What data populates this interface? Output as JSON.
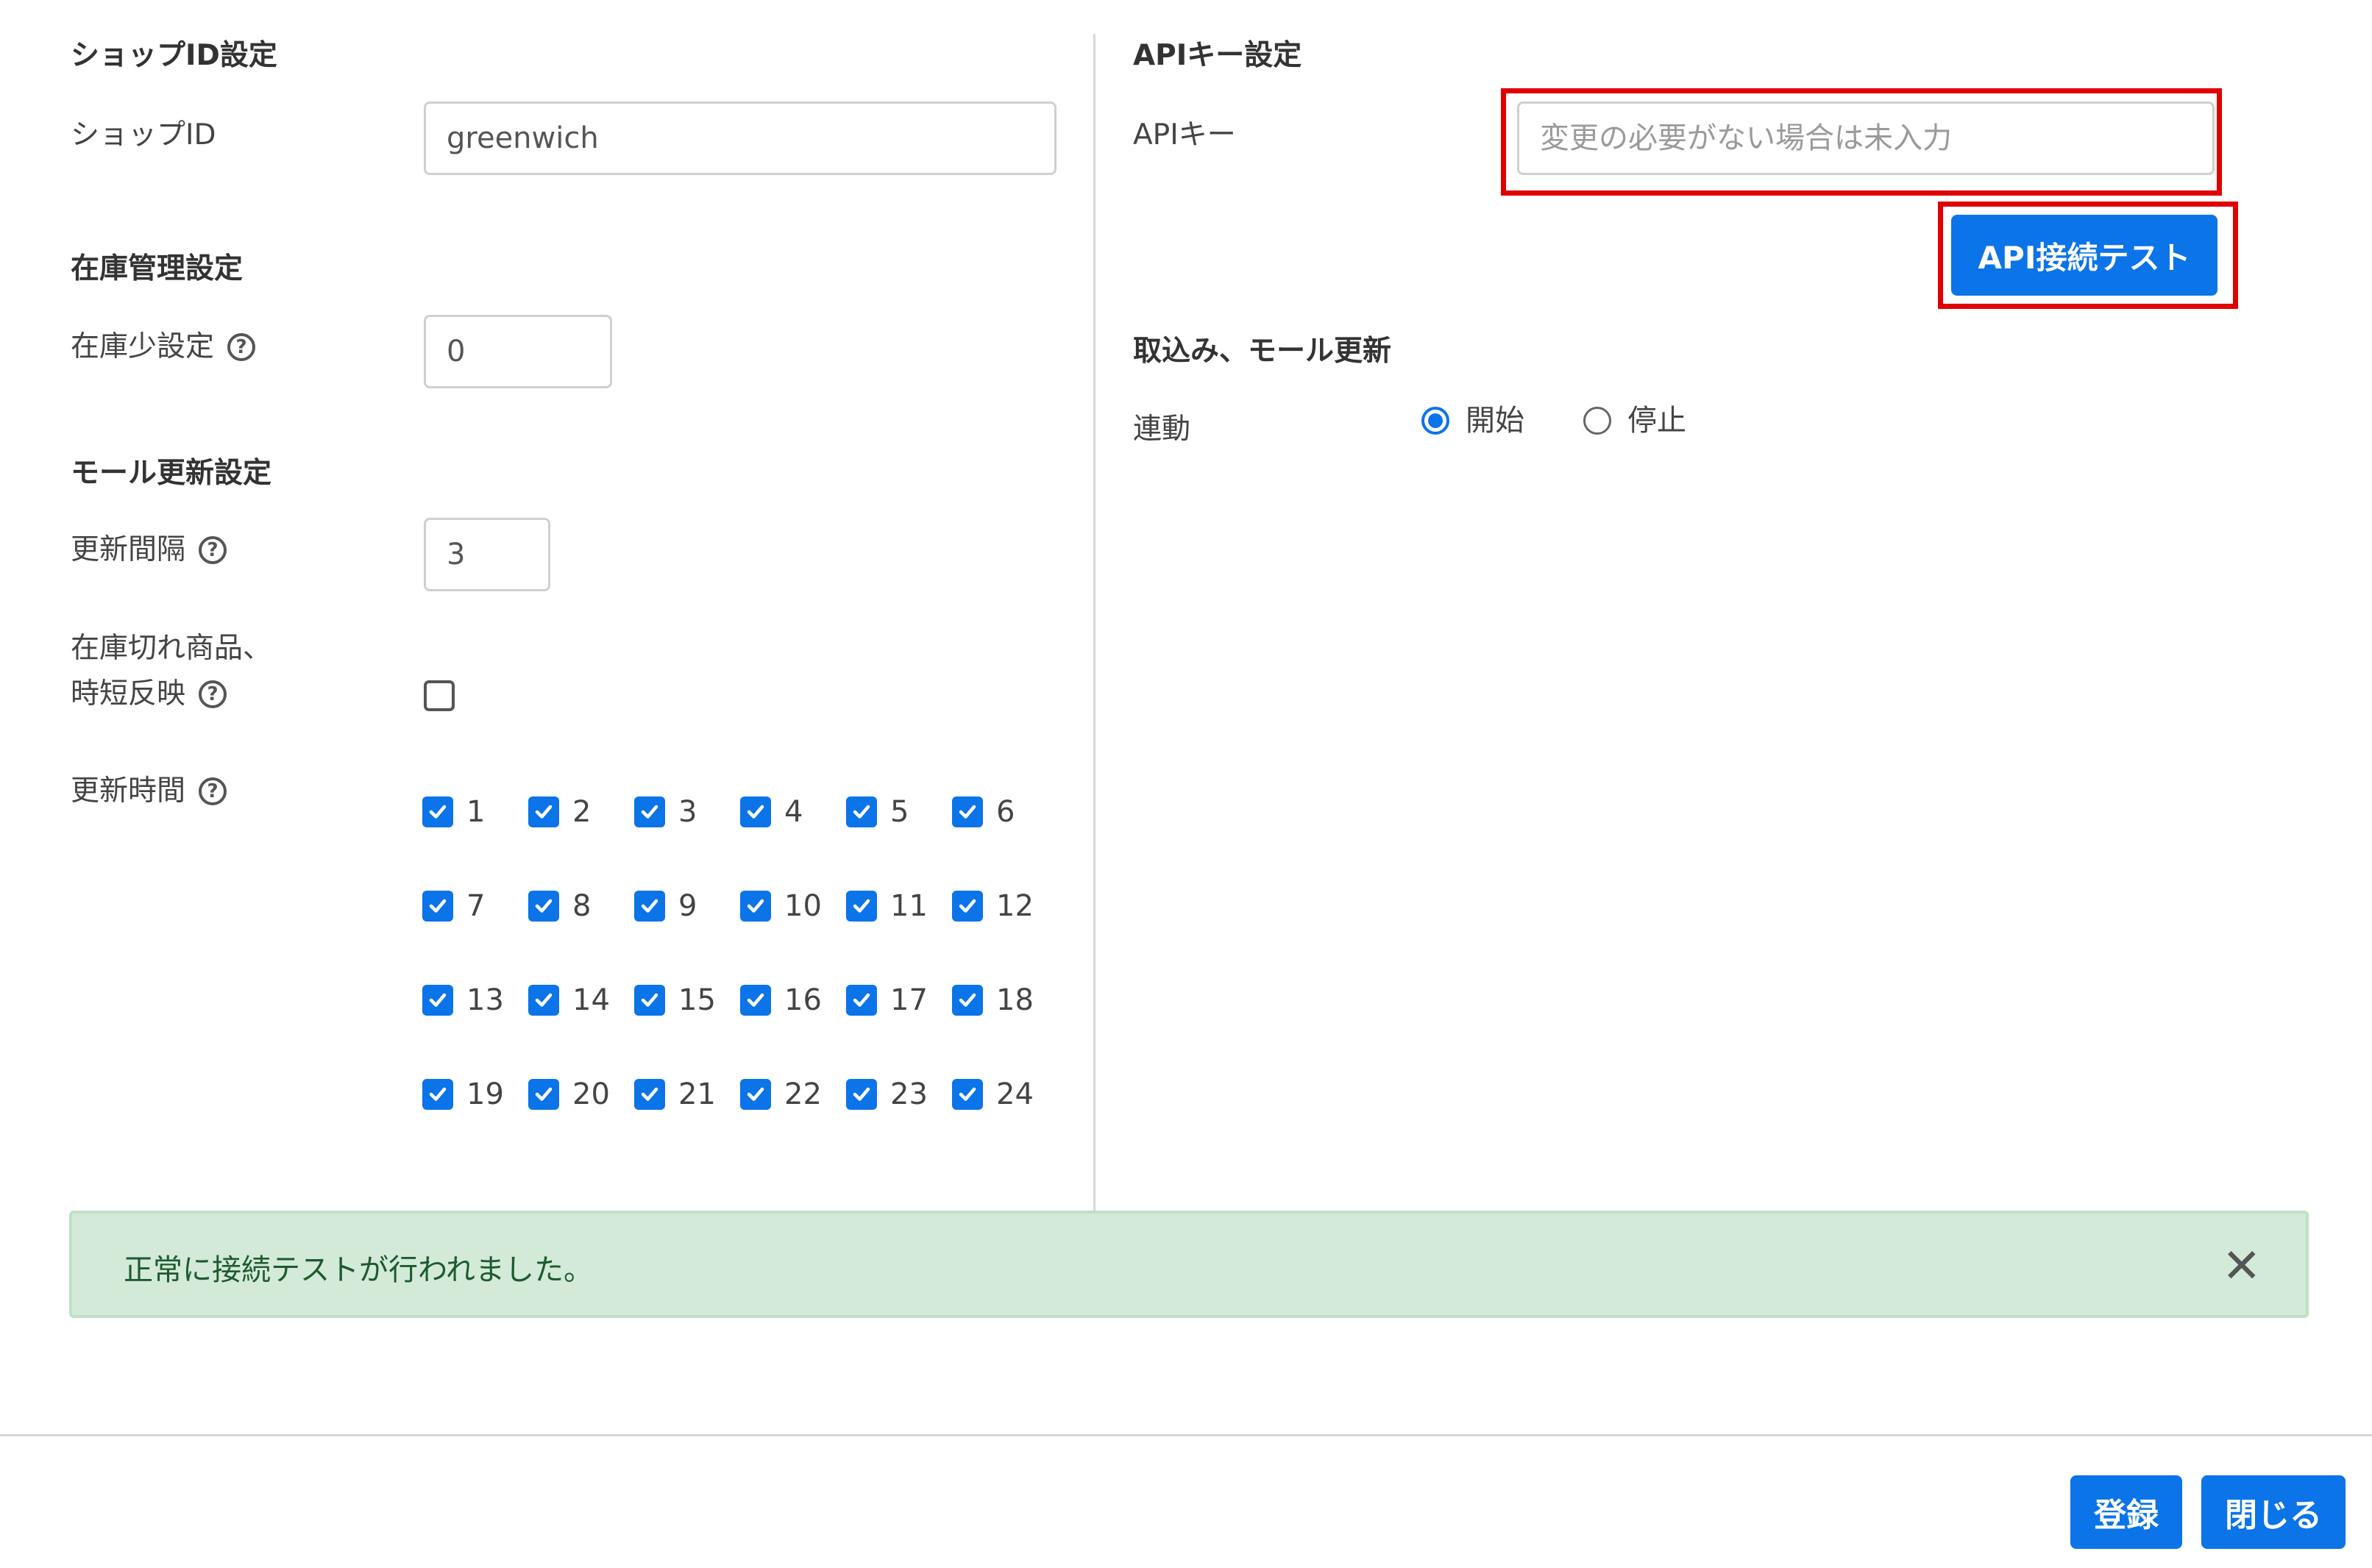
{
  "shop_id_section": {
    "heading": "ショップID設定",
    "shop_id_label": "ショップID",
    "shop_id_value": "greenwich"
  },
  "inventory_section": {
    "heading": "在庫管理設定",
    "low_stock_label": "在庫少設定",
    "low_stock_value": "0"
  },
  "mall_update_section": {
    "heading": "モール更新設定",
    "interval_label": "更新間隔",
    "interval_value": "3",
    "out_of_stock_label_line1": "在庫切れ商品、",
    "out_of_stock_label_line2": "時短反映",
    "out_of_stock_checked": false,
    "update_time_label": "更新時間",
    "hours": [
      "1",
      "2",
      "3",
      "4",
      "5",
      "6",
      "7",
      "8",
      "9",
      "10",
      "11",
      "12",
      "13",
      "14",
      "15",
      "16",
      "17",
      "18",
      "19",
      "20",
      "21",
      "22",
      "23",
      "24"
    ],
    "hours_checked": true
  },
  "api_section": {
    "heading": "APIキー設定",
    "api_key_label": "APIキー",
    "api_key_placeholder": "変更の必要がない場合は未入力",
    "test_button": "API接続テスト"
  },
  "import_section": {
    "heading": "取込み、モール更新",
    "link_label": "連動",
    "options": [
      "開始",
      "停止"
    ],
    "selected": "開始"
  },
  "help_glyph": "?",
  "alert": {
    "message": "正常に接続テストが行われました。",
    "close_glyph": "✕"
  },
  "footer": {
    "register_button": "登録",
    "close_button": "閉じる"
  },
  "colors": {
    "accent": "#0b74e8",
    "alert_bg": "#d3ead9",
    "highlight": "#e00000"
  }
}
